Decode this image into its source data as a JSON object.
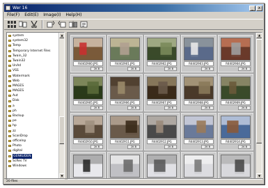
{
  "window": {
    "title": "Wer 16",
    "minimize": "_",
    "close": "x"
  },
  "menu": [
    "File(F)",
    "Edit(E)",
    "Image(I)",
    "Help(H)"
  ],
  "tree": {
    "items": [
      {
        "label": "system"
      },
      {
        "label": "system32"
      },
      {
        "label": "Temp"
      },
      {
        "label": "Temporary Internet Files"
      },
      {
        "label": "Twain_32"
      },
      {
        "label": "Twain32"
      },
      {
        "label": "UnAd"
      },
      {
        "label": "VSS"
      },
      {
        "label": "Watermark"
      },
      {
        "label": "Web"
      },
      {
        "label": "MAGES"
      },
      {
        "label": "MAGES"
      },
      {
        "label": "Aut"
      },
      {
        "label": "Disk"
      },
      {
        "label": "a"
      },
      {
        "label": "ph"
      },
      {
        "label": "Backup"
      },
      {
        "label": "pe"
      },
      {
        "label": "hp"
      },
      {
        "label": "zz"
      },
      {
        "label": "ScanDrop"
      },
      {
        "label": "officelnp"
      },
      {
        "label": "Photo"
      },
      {
        "label": "digital"
      },
      {
        "label": "GENKUDEN",
        "selected": true
      },
      {
        "label": "ScRes TV"
      },
      {
        "label": "Windows"
      }
    ]
  },
  "thumbnails": [
    {
      "name": "R4402900.JPG",
      "size": "2K B"
    },
    {
      "name": "R4402901.JPG",
      "size": "2K B"
    },
    {
      "name": "R4402902.JPG",
      "size": "2K B"
    },
    {
      "name": "R4402903.JPG",
      "size": "2K B"
    },
    {
      "name": "R4402904.JPG",
      "size": "2K B"
    },
    {
      "name": "R4402905.JPG",
      "size": "2K B"
    },
    {
      "name": "R4402906.JPG",
      "size": "2K B"
    },
    {
      "name": "R4402907.JPG",
      "size": "2K B"
    },
    {
      "name": "R4402908.JPG",
      "size": "2K B"
    },
    {
      "name": "R4402909.JPG",
      "size": "2K B"
    },
    {
      "name": "R4402910.JPG",
      "size": "2K B"
    },
    {
      "name": "R4402911.JPG",
      "size": "2K B"
    },
    {
      "name": "R4402912.JPG",
      "size": "2K B"
    },
    {
      "name": "R4402913.JPG",
      "size": "2K B"
    },
    {
      "name": "R4402914.JPG",
      "size": "2K B"
    },
    {
      "name": "",
      "size": ""
    },
    {
      "name": "",
      "size": ""
    },
    {
      "name": "",
      "size": ""
    },
    {
      "name": "",
      "size": ""
    },
    {
      "name": "",
      "size": ""
    }
  ],
  "status": "20 files"
}
